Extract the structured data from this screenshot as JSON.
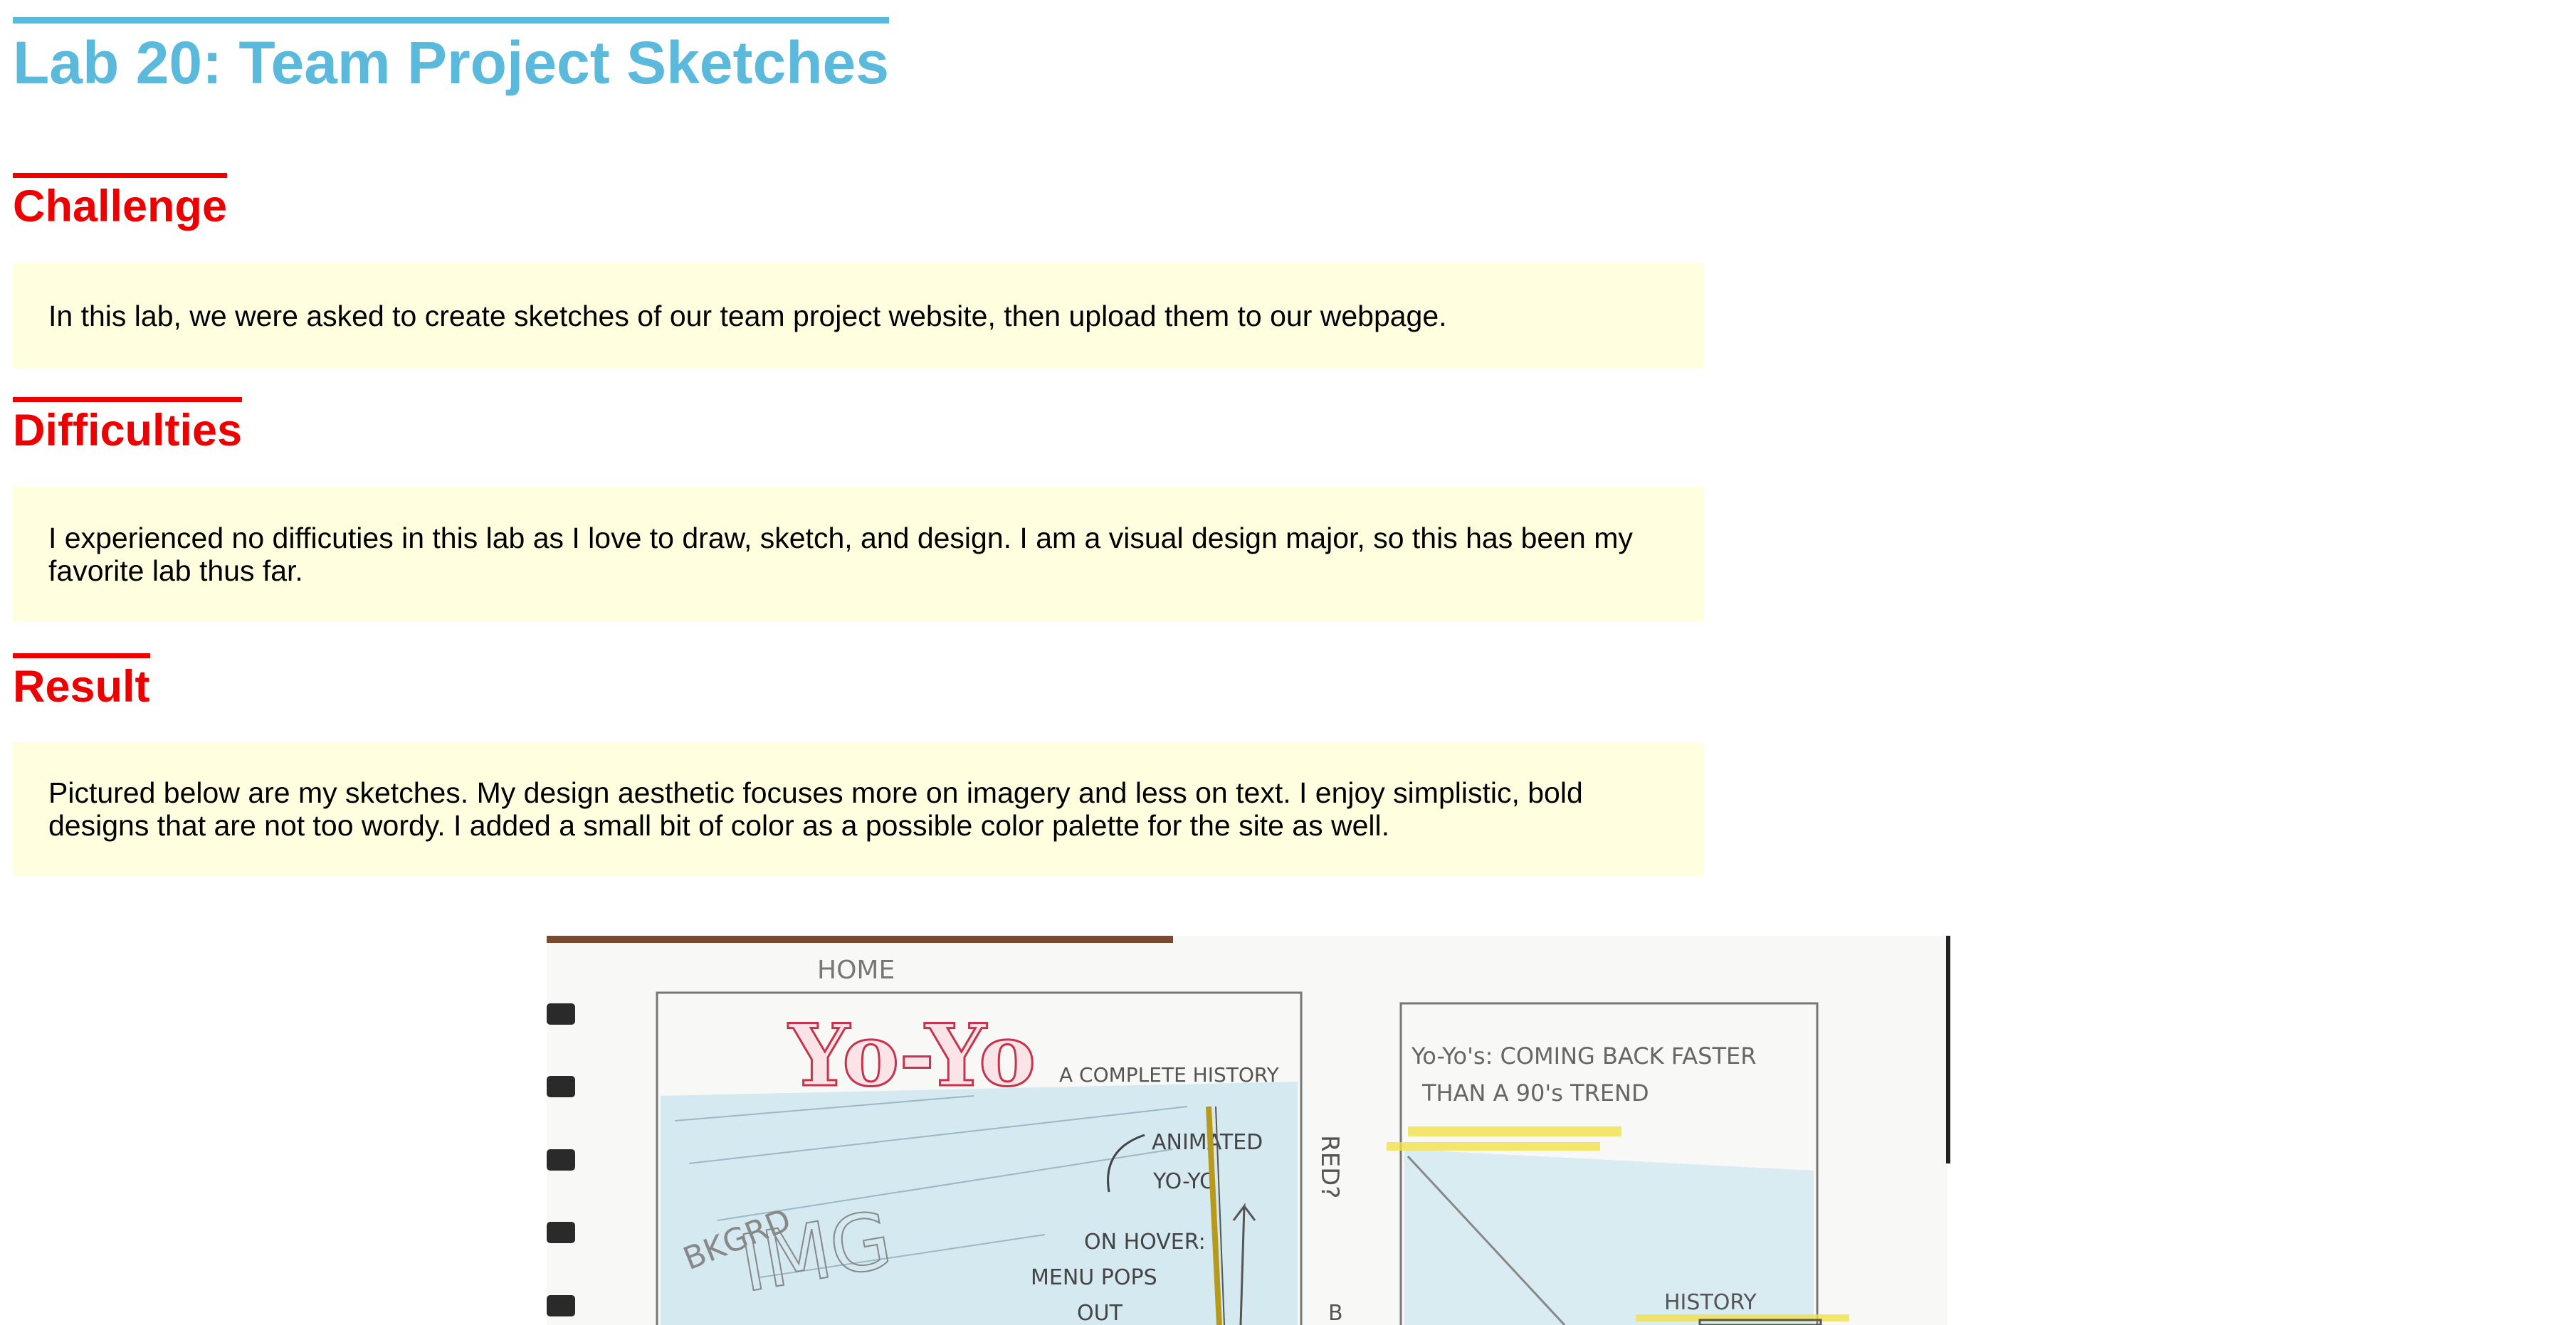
{
  "page": {
    "title": "Lab 20: Team Project Sketches"
  },
  "sections": [
    {
      "heading": "Challenge",
      "body": "In this lab, we were asked to create sketches of our team project website, then upload them to our webpage."
    },
    {
      "heading": "Difficulties",
      "body": "I experienced no difficuties in this lab as I love to draw, sketch, and design. I am a visual design major, so this has been my favorite lab thus far."
    },
    {
      "heading": "Result",
      "body": "Pictured below are my sketches. My design aesthetic focuses more on imagery and less on text. I enjoy simplistic, bold designs that are not too wordy. I added a small bit of color as a possible color palette for the site as well."
    }
  ],
  "sketch": {
    "home_label": "HOME",
    "logo": "Yo-Yo",
    "logo_tagline": "A COMPLETE HISTORY",
    "bkgrd_label": "BKGRD",
    "img_label": "IMG",
    "animated_label": "ANIMATED",
    "yoyo_label": "YO-YO",
    "on_hover_label": "ON HOVER:",
    "menu_label": "MENU POPS",
    "out_label": "OUT",
    "red_label": "RED?",
    "b_label": "B",
    "right_heading_1": "Yo-Yo's: COMING BACK FASTER",
    "right_heading_2": "THAN A 90's TREND",
    "history_label": "HISTORY",
    "colors": {
      "sky": "#cfe6ee",
      "pencil": "#6a6a6a",
      "red": "#c8324a",
      "yellow": "#f2e04a"
    }
  }
}
